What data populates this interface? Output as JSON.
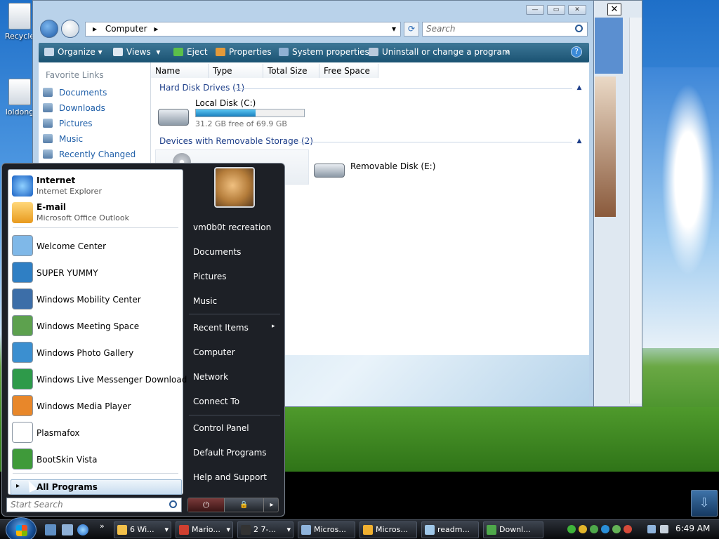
{
  "desktop": {
    "icons": [
      {
        "label": "Recycle",
        "icon": "recycle-bin-icon"
      },
      {
        "label": "loldong",
        "icon": "document-icon"
      }
    ],
    "show_desktop_glyph": "⇩"
  },
  "back_window": {
    "close_glyph": "✕"
  },
  "explorer": {
    "window_buttons": {
      "minimize": "—",
      "maximize": "▭",
      "close": "✕"
    },
    "address": {
      "root_glyph": "▸",
      "location": "Computer",
      "crumb_glyph": "▸",
      "dropdown_glyph": "▾",
      "refresh_glyph": "⟳"
    },
    "search_placeholder": "Search",
    "toolbar": {
      "organize": "Organize",
      "views": "Views",
      "eject": "Eject",
      "properties": "Properties",
      "system_properties": "System properties",
      "uninstall": "Uninstall or change a program",
      "more": "»",
      "help": "?"
    },
    "favorite_links": {
      "title": "Favorite Links",
      "items": [
        "Documents",
        "Downloads",
        "Pictures",
        "Music",
        "Recently Changed"
      ]
    },
    "columns": [
      "Name",
      "Type",
      "Total Size",
      "Free Space"
    ],
    "groups": [
      {
        "title": "Hard Disk Drives (1)",
        "drive": {
          "name": "Local Disk (C:)",
          "free_text": "31.2 GB free of 69.9 GB",
          "used_fraction": 0.554
        }
      },
      {
        "title": "Devices with Removable Storage (2)",
        "drive": {
          "name": "Removable Disk (E:)"
        }
      }
    ],
    "collapse_glyph": "▲"
  },
  "start_menu": {
    "pinned": [
      {
        "name": "Internet",
        "sub": "Internet Explorer",
        "icon": "internet-explorer-icon"
      },
      {
        "name": "E-mail",
        "sub": "Microsoft Office Outlook",
        "icon": "outlook-icon"
      }
    ],
    "recent": [
      {
        "name": "Welcome Center",
        "icon": "welcome-center-icon"
      },
      {
        "name": "SUPER YUMMY",
        "icon": "super-yummy-icon"
      },
      {
        "name": "Windows Mobility Center",
        "icon": "mobility-center-icon"
      },
      {
        "name": "Windows Meeting Space",
        "icon": "meeting-space-icon"
      },
      {
        "name": "Windows Photo Gallery",
        "icon": "photo-gallery-icon"
      },
      {
        "name": "Windows Live Messenger Download",
        "icon": "messenger-icon"
      },
      {
        "name": "Windows Media Player",
        "icon": "media-player-icon"
      },
      {
        "name": "Plasmafox",
        "icon": "plasmafox-icon"
      },
      {
        "name": "BootSkin Vista",
        "icon": "bootskin-icon"
      }
    ],
    "all_programs": "All Programs",
    "all_programs_glyph": "▸",
    "search_placeholder": "Start Search",
    "right": {
      "user": "vm0b0t recreation",
      "documents": "Documents",
      "pictures": "Pictures",
      "music": "Music",
      "recent_items": "Recent Items",
      "computer": "Computer",
      "network": "Network",
      "connect_to": "Connect To",
      "control_panel": "Control Panel",
      "default_programs": "Default Programs",
      "help_support": "Help and Support"
    },
    "submenu_glyph": "▸",
    "power": {
      "power_glyph": "⏻",
      "lock_glyph": "🔒",
      "arrow_glyph": "▸"
    }
  },
  "taskbar": {
    "more_glyph": "»",
    "buttons": [
      {
        "label": "6 Wi...",
        "icon": "folder-icon",
        "color": "#f2c04a",
        "dropdown": true
      },
      {
        "label": "Mario...",
        "icon": "game-icon",
        "color": "#d04030",
        "dropdown": true
      },
      {
        "label": "2 7-...",
        "icon": "7zip-icon",
        "color": "#333333",
        "dropdown": true
      },
      {
        "label": "Micros...",
        "icon": "window-icon",
        "color": "#8fb4dc",
        "dropdown": false
      },
      {
        "label": "Micros...",
        "icon": "outlook-icon",
        "color": "#f0b030",
        "dropdown": false
      },
      {
        "label": "readm...",
        "icon": "notepad-icon",
        "color": "#9fc7e8",
        "dropdown": false
      },
      {
        "label": "Downl...",
        "icon": "download-icon",
        "color": "#4ea84a",
        "dropdown": false
      }
    ],
    "clock": "6:49 AM"
  },
  "colors": {
    "accent": "#1e5ea8",
    "toolbar": "#1a5272",
    "start_menu": "#1d2026"
  }
}
